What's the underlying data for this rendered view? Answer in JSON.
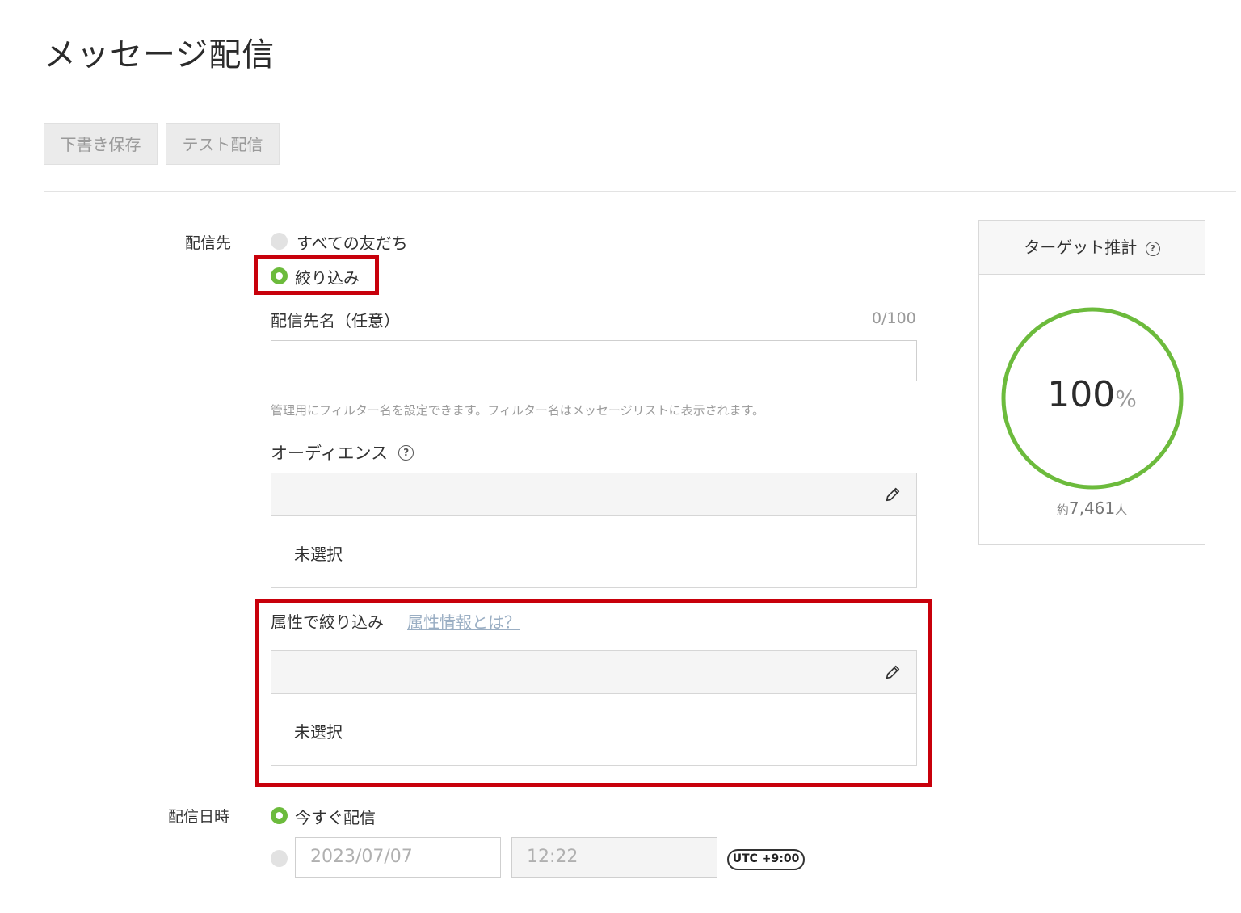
{
  "page": {
    "title": "メッセージ配信"
  },
  "toolbar": {
    "draft_label": "下書き保存",
    "test_label": "テスト配信"
  },
  "destination": {
    "label": "配信先",
    "options": [
      {
        "label": "すべての友だち",
        "selected": false
      },
      {
        "label": "絞り込み",
        "selected": true
      }
    ],
    "name_field": {
      "label": "配信先名（任意）",
      "counter": "0/100",
      "value": "",
      "placeholder": ""
    },
    "name_hint": "管理用にフィルター名を設定できます。フィルター名はメッセージリストに表示されます。",
    "audience": {
      "label": "オーディエンス",
      "value": "未選択"
    },
    "attribute": {
      "label": "属性で絞り込み",
      "link": "属性情報とは？",
      "value": "未選択"
    }
  },
  "schedule": {
    "label": "配信日時",
    "options": [
      {
        "label": "今すぐ配信",
        "selected": true
      },
      {
        "label": "",
        "selected": false
      }
    ],
    "date": "2023/07/07",
    "time": "12:22",
    "timezone": "UTC +9:00"
  },
  "target": {
    "title": "ターゲット推計",
    "percent_number": "100",
    "percent_unit": "%",
    "percent_value": 100,
    "count_prefix": "約",
    "count": "7,461",
    "count_suffix": "人"
  },
  "colors": {
    "accent_green": "#6cbb3c",
    "highlight_red": "#c8000b",
    "link": "#9aaec3"
  }
}
